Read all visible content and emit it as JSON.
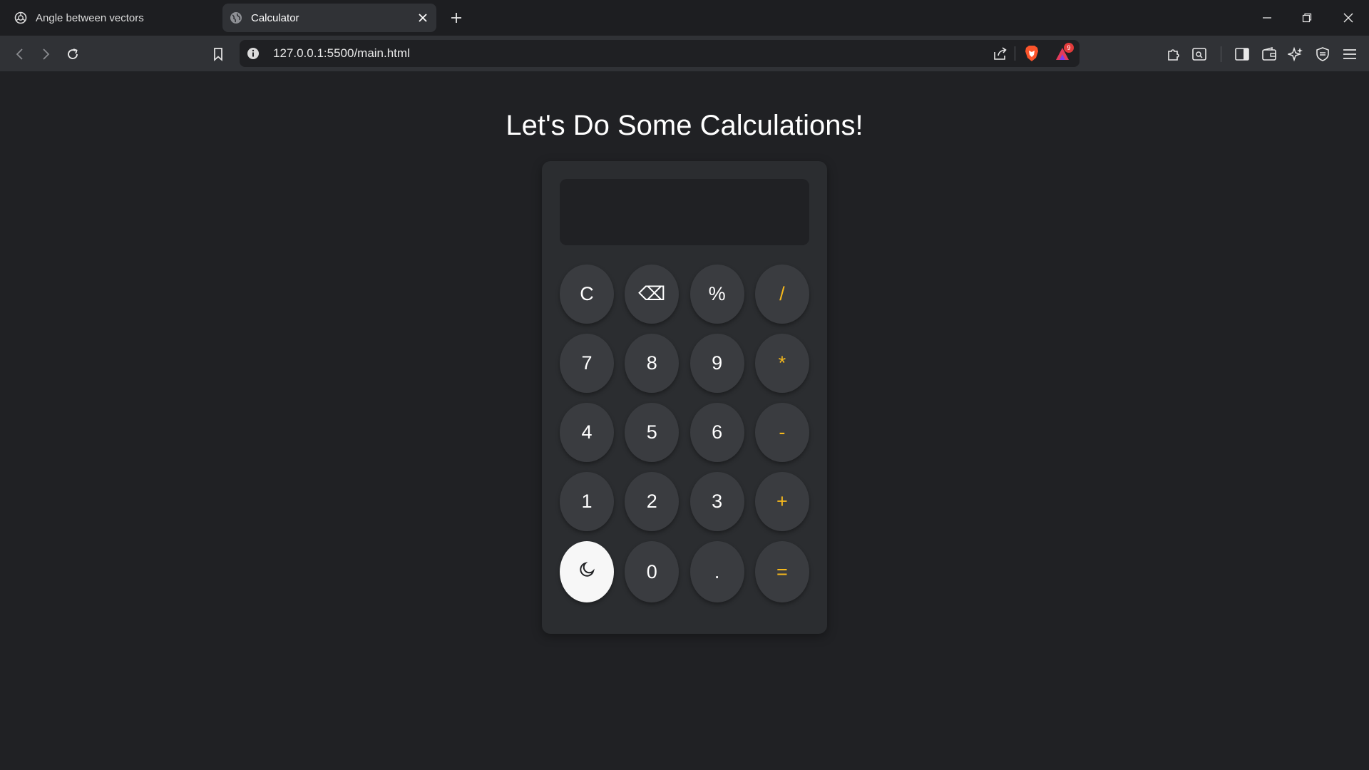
{
  "browser": {
    "tabs": [
      {
        "title": "Angle between vectors",
        "active": false,
        "favicon": "openai-icon"
      },
      {
        "title": "Calculator",
        "active": true,
        "favicon": "globe-icon"
      }
    ],
    "url": "127.0.0.1:5500/main.html",
    "rewards_badge": "9"
  },
  "page": {
    "heading": "Let's Do Some Calculations!"
  },
  "calculator": {
    "display_value": "",
    "keys": [
      {
        "label": "C",
        "name": "clear-button",
        "kind": "fn"
      },
      {
        "label": "⌫",
        "name": "backspace-button",
        "kind": "fn"
      },
      {
        "label": "%",
        "name": "percent-button",
        "kind": "fn"
      },
      {
        "label": "/",
        "name": "divide-button",
        "kind": "op"
      },
      {
        "label": "7",
        "name": "digit-7-button",
        "kind": "num"
      },
      {
        "label": "8",
        "name": "digit-8-button",
        "kind": "num"
      },
      {
        "label": "9",
        "name": "digit-9-button",
        "kind": "num"
      },
      {
        "label": "*",
        "name": "multiply-button",
        "kind": "op"
      },
      {
        "label": "4",
        "name": "digit-4-button",
        "kind": "num"
      },
      {
        "label": "5",
        "name": "digit-5-button",
        "kind": "num"
      },
      {
        "label": "6",
        "name": "digit-6-button",
        "kind": "num"
      },
      {
        "label": "-",
        "name": "subtract-button",
        "kind": "op"
      },
      {
        "label": "1",
        "name": "digit-1-button",
        "kind": "num"
      },
      {
        "label": "2",
        "name": "digit-2-button",
        "kind": "num"
      },
      {
        "label": "3",
        "name": "digit-3-button",
        "kind": "num"
      },
      {
        "label": "+",
        "name": "add-button",
        "kind": "op"
      },
      {
        "label": "",
        "name": "theme-toggle-button",
        "kind": "theme",
        "icon": "moon-icon"
      },
      {
        "label": "0",
        "name": "digit-0-button",
        "kind": "num"
      },
      {
        "label": ".",
        "name": "decimal-button",
        "kind": "num"
      },
      {
        "label": "=",
        "name": "equals-button",
        "kind": "op"
      }
    ]
  },
  "colors": {
    "page_bg": "#202124",
    "calc_bg": "#2b2d30",
    "key_bg": "#3a3c40",
    "operator": "#f5b81c",
    "theme_key_bg": "#f7f7f7"
  }
}
